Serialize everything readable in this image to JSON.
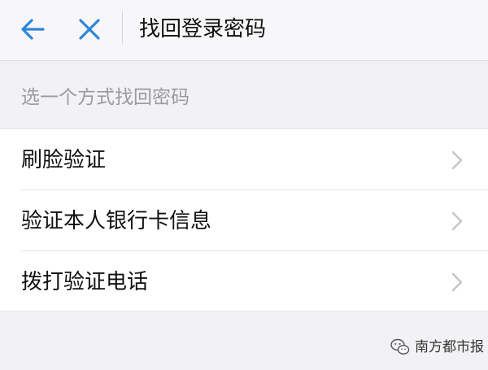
{
  "navbar": {
    "back_icon": "arrow-left-icon",
    "close_icon": "close-icon",
    "title": "找回登录密码",
    "accent_color": "#2f86d8"
  },
  "section": {
    "header": "选一个方式找回密码"
  },
  "options": [
    {
      "label": "刷脸验证",
      "icon": "chevron-right-icon"
    },
    {
      "label": "验证本人银行卡信息",
      "icon": "chevron-right-icon"
    },
    {
      "label": "拨打验证电话",
      "icon": "chevron-right-icon"
    }
  ],
  "watermark": {
    "icon": "wechat-icon",
    "text": "南方都市报"
  }
}
